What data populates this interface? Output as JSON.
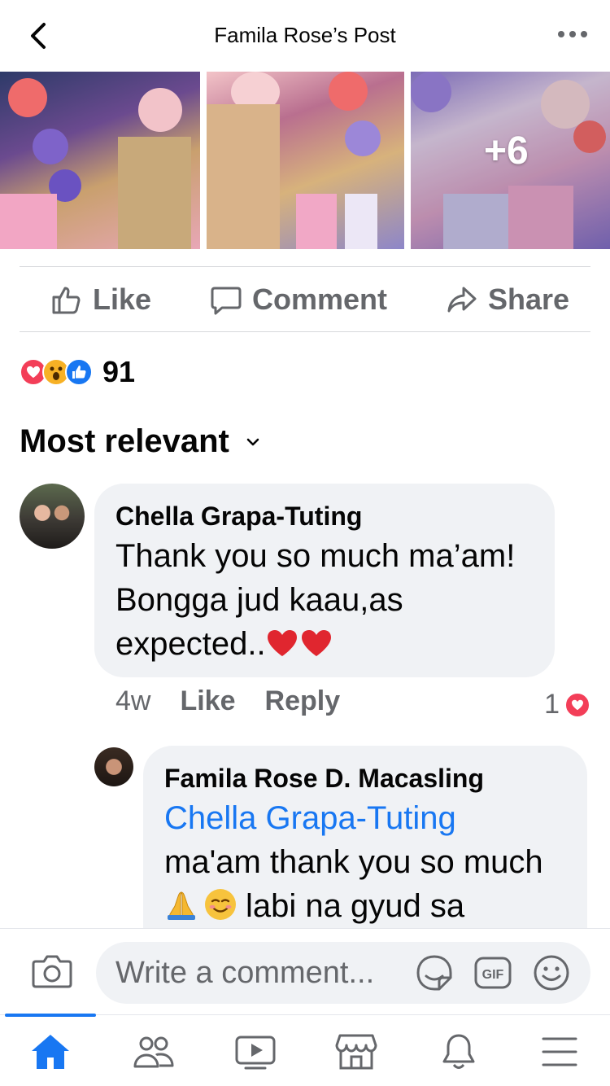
{
  "header": {
    "title": "Famila Rose’s Post",
    "back_icon": "chevron-left-icon",
    "more_icon": "more-horizontal-icon"
  },
  "photos": {
    "more_count": "+6"
  },
  "actions": {
    "like_label": "Like",
    "comment_label": "Comment",
    "share_label": "Share"
  },
  "reactions": {
    "types": [
      "love",
      "wow",
      "like"
    ],
    "count": "91"
  },
  "sort": {
    "label": "Most relevant"
  },
  "comments": [
    {
      "author": "Chella Grapa-Tuting",
      "text_line1": "Thank you so much ma’am!",
      "text_line2": "Bongga jud kaau,as",
      "text_line3": "expected..",
      "emoji": "❤️❤️",
      "time": "4w",
      "like_label": "Like",
      "reply_label": "Reply",
      "reaction_count": "1"
    },
    {
      "author": "Famila Rose D. Macasling",
      "mention": "Chella Grapa-Tuting",
      "text_line1": "ma'am thank you so much",
      "text_line2": "labi na gyud sa",
      "emoji": "🙏☺️"
    }
  ],
  "composer": {
    "placeholder": "Write a comment..."
  },
  "nav": {
    "items": [
      "home-icon",
      "friends-icon",
      "watch-icon",
      "marketplace-icon",
      "notifications-icon",
      "menu-icon"
    ]
  },
  "colors": {
    "accent": "#1877f2",
    "secondary_text": "#65676b",
    "bubble": "#f0f2f5",
    "love": "#f33e58",
    "wow": "#f7b125"
  }
}
